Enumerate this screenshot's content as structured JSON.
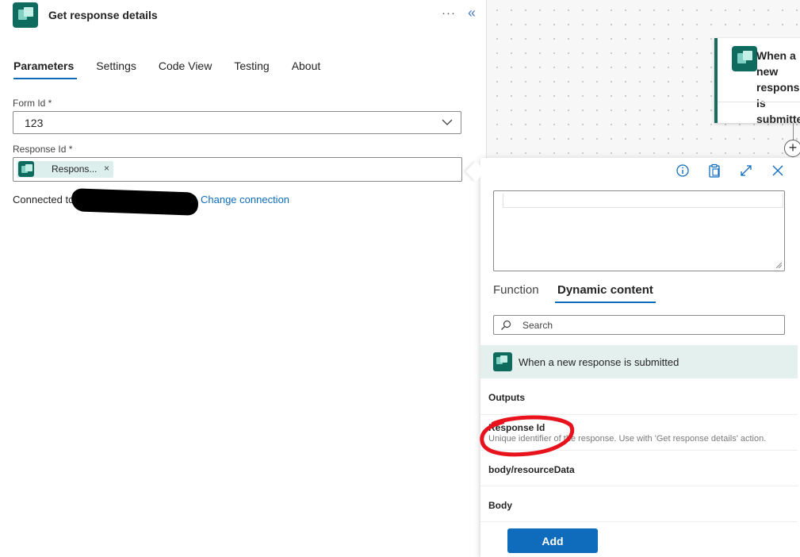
{
  "panel": {
    "title": "Get response details",
    "more_icon": "more-horizontal-icon",
    "collapse_icon": "collapse-chevrons-icon"
  },
  "tabs": [
    {
      "label": "Parameters",
      "active": true
    },
    {
      "label": "Settings",
      "active": false
    },
    {
      "label": "Code View",
      "active": false
    },
    {
      "label": "Testing",
      "active": false
    },
    {
      "label": "About",
      "active": false
    }
  ],
  "form_id": {
    "label": "Form Id *",
    "value": "123"
  },
  "response_id": {
    "label": "Response Id *",
    "token_label": "Respons...",
    "token_remove": "×"
  },
  "connection": {
    "prefix": "Connected to",
    "change_link": "Change connection"
  },
  "canvas": {
    "trigger_card_title": "When a new\nresponse is\nsubmitted",
    "add_step_glyph": "+"
  },
  "flyout": {
    "tabs": [
      {
        "label": "Function",
        "active": false
      },
      {
        "label": "Dynamic content",
        "active": true
      }
    ],
    "search_placeholder": "Search",
    "section_title": "When a new response is submitted",
    "items": [
      {
        "title": "Outputs",
        "description": ""
      },
      {
        "title": "Response Id",
        "description": "Unique identifier of the response. Use with 'Get response details' action."
      },
      {
        "title": "body/resourceData",
        "description": ""
      },
      {
        "title": "Body",
        "description": ""
      }
    ],
    "add_label": "Add"
  },
  "colors": {
    "accent": "#0f6cbd",
    "forms_icon": "#0f6b5e",
    "section_bg": "#e3f0ee",
    "annotation": "#e8121c"
  }
}
